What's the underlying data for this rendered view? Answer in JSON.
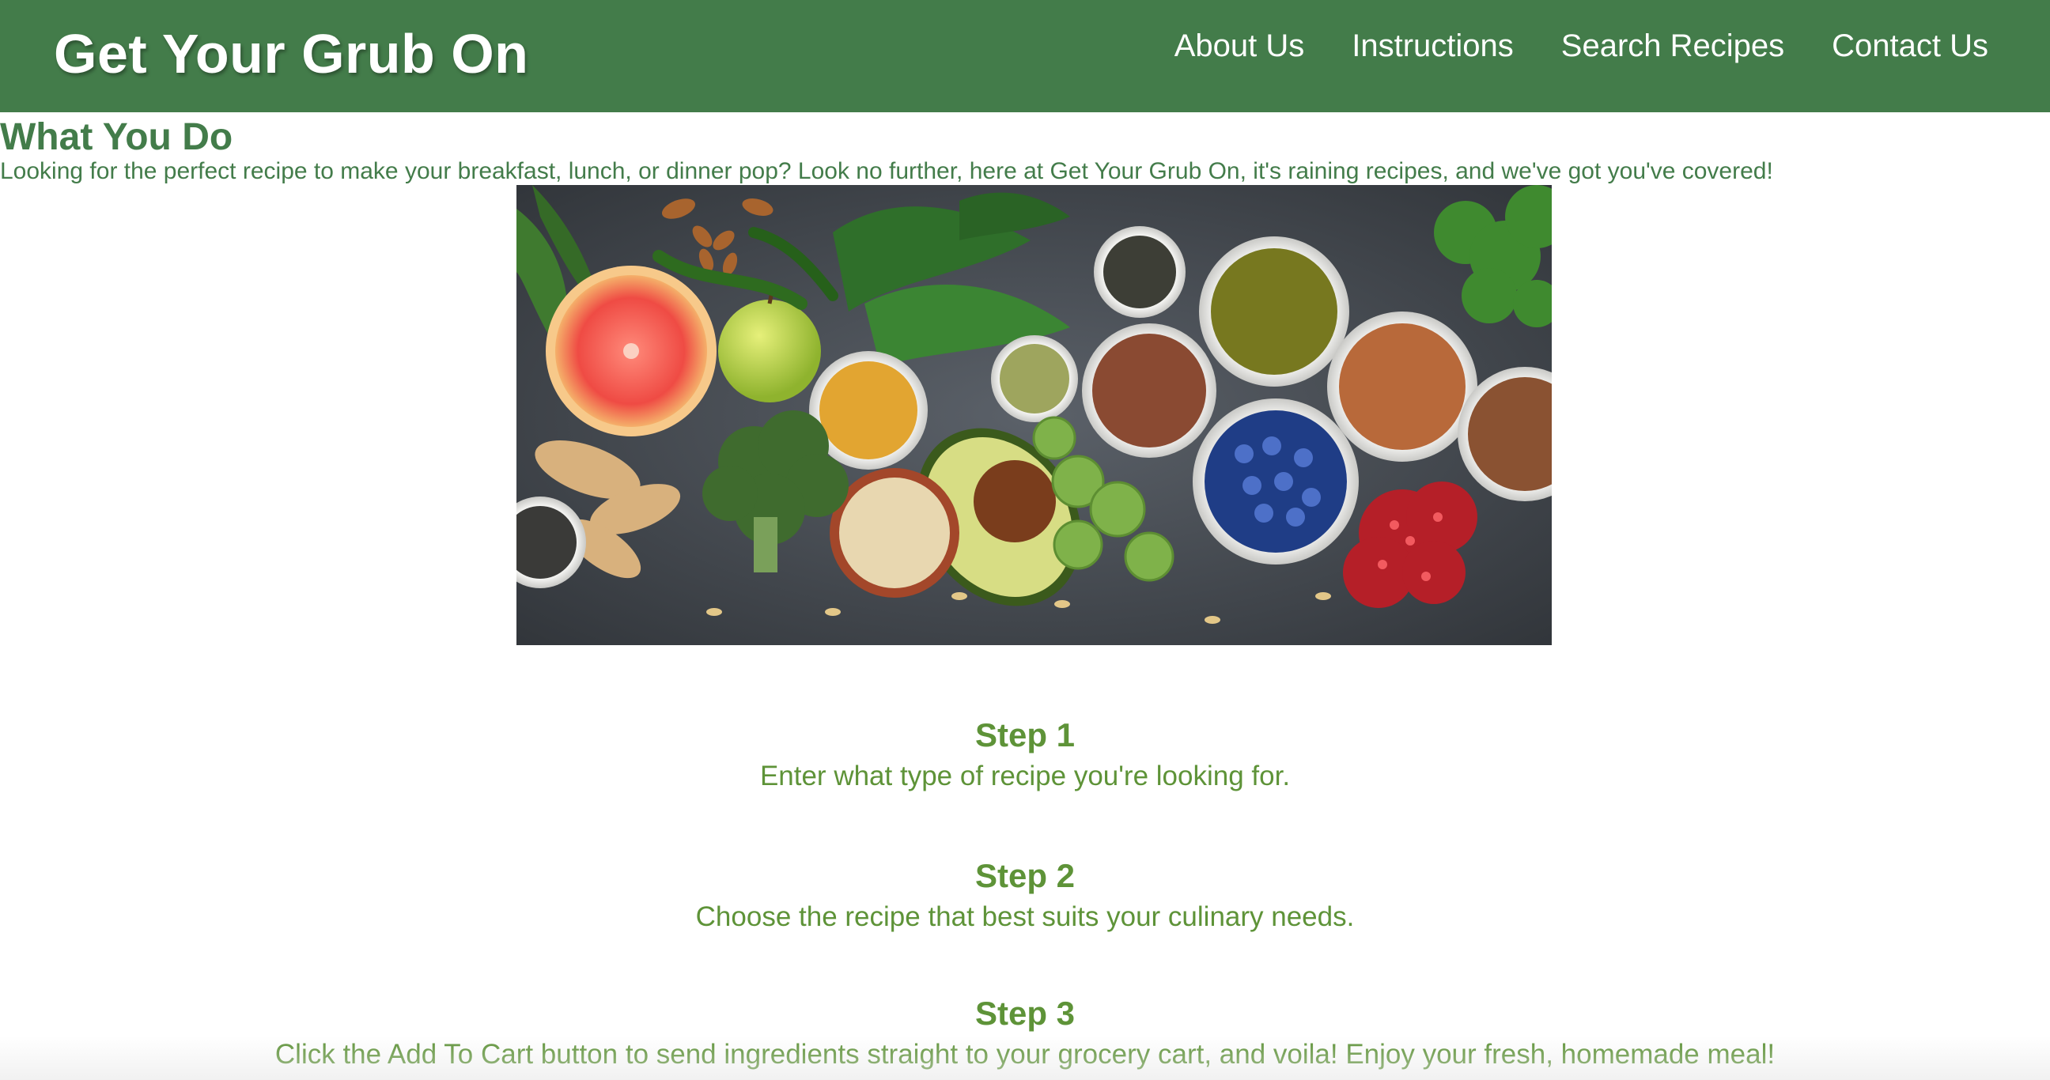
{
  "header": {
    "brand": "Get Your Grub On",
    "nav": [
      {
        "label": "About Us"
      },
      {
        "label": "Instructions"
      },
      {
        "label": "Search Recipes"
      },
      {
        "label": "Contact Us"
      }
    ]
  },
  "main": {
    "title": "What You Do",
    "description": "Looking for the perfect recipe to make your breakfast, lunch, or dinner pop? Look no further, here at Get Your Grub On, it's raining recipes, and we've got you've covered!",
    "steps": [
      {
        "title": "Step 1",
        "text": "Enter what type of recipe you're looking for."
      },
      {
        "title": "Step 2",
        "text": "Choose the recipe that best suits your culinary needs."
      },
      {
        "title": "Step 3",
        "text": "Click the Add To Cart button to send ingredients straight to your grocery cart, and voila! Enjoy your fresh, homemade meal!"
      }
    ]
  },
  "colors": {
    "header_bg": "#437c4a",
    "heading_text": "#437c4a",
    "step_text": "#5e9338"
  }
}
